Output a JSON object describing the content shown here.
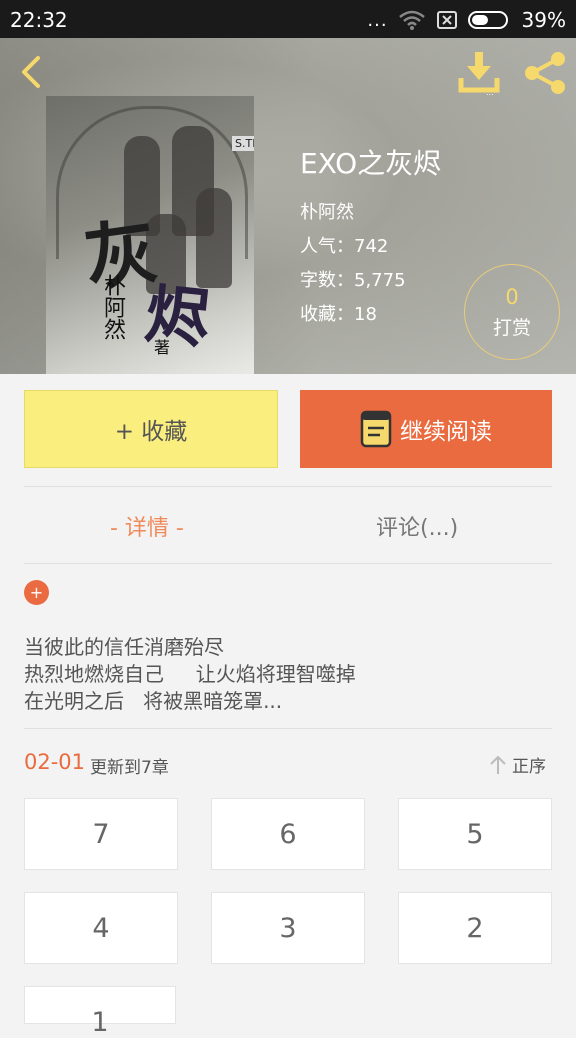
{
  "status_bar": {
    "time": "22:32",
    "dots": "...",
    "battery": "39%"
  },
  "book": {
    "title": "EXO之灰烬",
    "author": "朴阿然",
    "popularity": "人气：742",
    "word_count": "字数：5,775",
    "favorites": "收藏：18",
    "cover_text_1": "灰",
    "cover_text_2": "烬",
    "cover_author": "朴阿然",
    "cover_mark": "著",
    "cover_tag": "S.TR"
  },
  "reward": {
    "count": "0",
    "label": "打赏"
  },
  "actions": {
    "favorite": "+ 收藏",
    "continue_reading": "继续阅读"
  },
  "tabs": {
    "detail": "- 详情 -",
    "comments": "评论(...)"
  },
  "description": "当彼此的信任消磨殆尽\n热烈地燃烧自己     让火焰将理智噬掉\n在光明之后   将被黑暗笼罩...",
  "update": {
    "date": "02-01",
    "text": "更新到7章",
    "sort_label": "正序"
  },
  "chapters": [
    "7",
    "6",
    "5",
    "4",
    "3",
    "2",
    "1"
  ],
  "colors": {
    "accent": "#e96b3f",
    "favorite_bg": "#f9ee7e",
    "icon_yellow": "#f6d96c"
  }
}
